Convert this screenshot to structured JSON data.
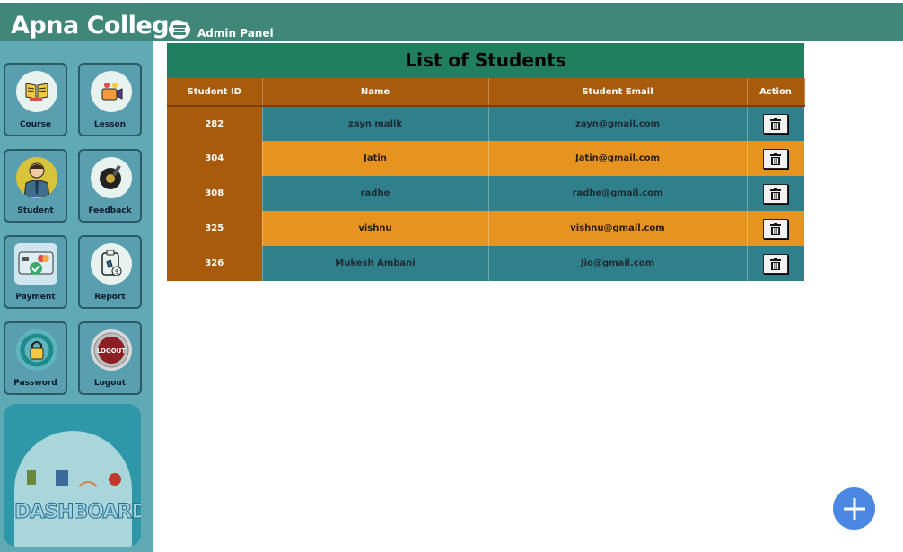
{
  "header": {
    "title": "Apna College",
    "subtitle": "Admin Panel"
  },
  "sidebar": {
    "tiles": [
      {
        "label": "Course"
      },
      {
        "label": "Lesson"
      },
      {
        "label": "Student"
      },
      {
        "label": "Feedback"
      },
      {
        "label": "Payment"
      },
      {
        "label": "Report"
      },
      {
        "label": "Password"
      },
      {
        "label": "Logout"
      }
    ],
    "dashboard_label": "DASHBOARD",
    "logout_icon_text": "LOGOUT"
  },
  "main": {
    "title": "List of Students",
    "columns": [
      "Student ID",
      "Name",
      "Student Email",
      "Action"
    ],
    "rows": [
      {
        "id": "282",
        "name": "zayn malik",
        "email": "zayn@gmail.com"
      },
      {
        "id": "304",
        "name": "Jatin",
        "email": "Jatin@gmail.com"
      },
      {
        "id": "308",
        "name": "radhe",
        "email": "radhe@gmail.com"
      },
      {
        "id": "325",
        "name": "vishnu",
        "email": "vishnu@gmail.com"
      },
      {
        "id": "326",
        "name": "Mukesh Ambani",
        "email": "Jio@gmail.com"
      }
    ]
  },
  "colors": {
    "header": "#418779",
    "sidebar": "#60aab5",
    "table_title": "#207f5f",
    "table_head": "#a85b0b",
    "row_teal": "#30808c",
    "row_orange": "#e6931f",
    "fab": "#4a88e4"
  },
  "icons": [
    "book-icon",
    "lesson-icon",
    "student-icon",
    "feedback-icon",
    "payment-icon",
    "report-icon",
    "password-icon",
    "logout-icon",
    "trash-icon",
    "plus-icon"
  ]
}
